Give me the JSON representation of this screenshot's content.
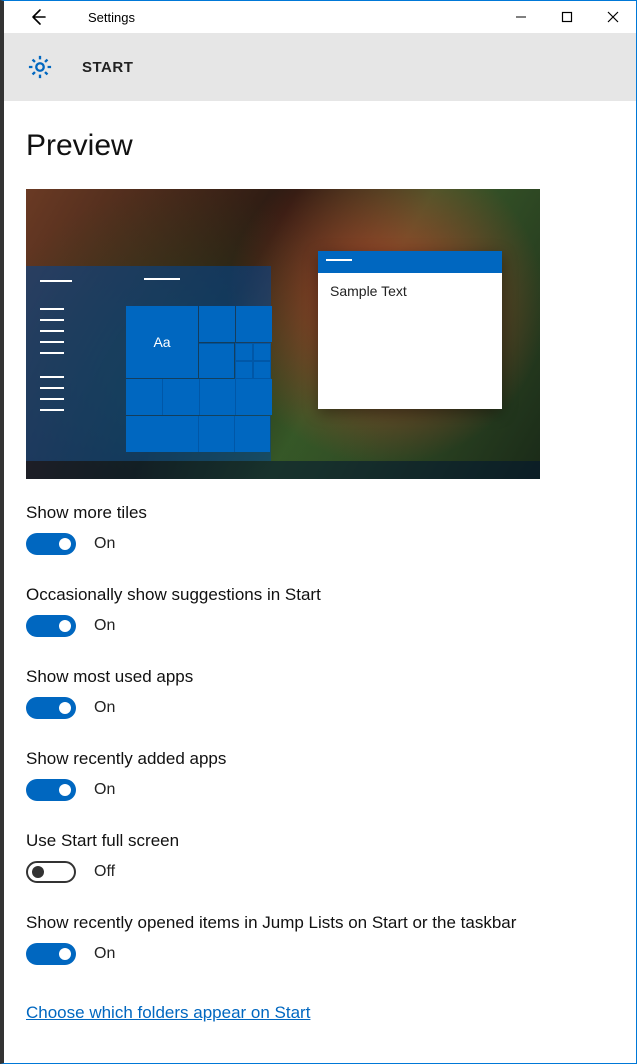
{
  "titlebar": {
    "title": "Settings"
  },
  "header": {
    "title": "START"
  },
  "page": {
    "heading": "Preview"
  },
  "preview": {
    "tile_text": "Aa",
    "window_sample": "Sample Text"
  },
  "toggles": {
    "on_label": "On",
    "off_label": "Off"
  },
  "settings": [
    {
      "label": "Show more tiles",
      "state": "on"
    },
    {
      "label": "Occasionally show suggestions in Start",
      "state": "on"
    },
    {
      "label": "Show most used apps",
      "state": "on"
    },
    {
      "label": "Show recently added apps",
      "state": "on"
    },
    {
      "label": "Use Start full screen",
      "state": "off"
    },
    {
      "label": "Show recently opened items in Jump Lists on Start or the taskbar",
      "state": "on"
    }
  ],
  "link": {
    "label": "Choose which folders appear on Start"
  }
}
